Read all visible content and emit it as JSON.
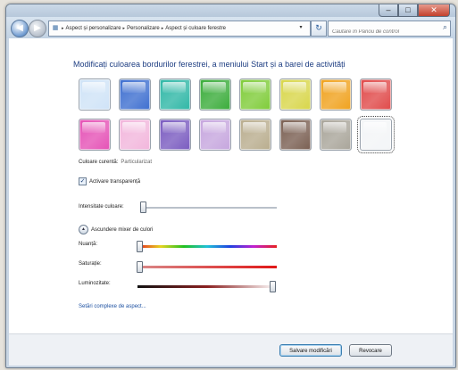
{
  "window": {
    "caption": {
      "minimize": "–",
      "maximize": "□",
      "close": "✕"
    }
  },
  "navbar": {
    "back_glyph": "◀",
    "forward_glyph": "▶",
    "breadcrumbs": [
      "Aspect și personalizare",
      "Personalizare",
      "Aspect și culoare ferestre"
    ],
    "refresh_glyph": "↻",
    "search_placeholder": "Căutare în Panou de control"
  },
  "main": {
    "heading": "Modificați culoarea bordurilor ferestrei, a meniului Start și a barei de activități",
    "current_color_label": "Culoare curentă:",
    "current_color_value": "Particularizat",
    "transparency_label": "Activare transparență",
    "transparency_checked": true,
    "intensity_label": "Intensitate culoare:",
    "intensity_value": 0.02,
    "mixer_label": "Ascundere mixer de culori",
    "hue_label": "Nuanță:",
    "hue_value": 0.01,
    "saturation_label": "Saturație:",
    "saturation_value": 0.01,
    "brightness_label": "Luminozitate:",
    "brightness_value": 0.97,
    "advanced_link": "Setări complexe de aspect..."
  },
  "swatches": [
    {
      "name": "sky",
      "color": "#cfe3f7"
    },
    {
      "name": "twilight",
      "color": "#3e6fd0"
    },
    {
      "name": "sea",
      "color": "#2fb7a6"
    },
    {
      "name": "leaf",
      "color": "#3aac3a"
    },
    {
      "name": "lime",
      "color": "#7fcc39"
    },
    {
      "name": "lemon",
      "color": "#d8d64a"
    },
    {
      "name": "pumpkin",
      "color": "#f0a21e"
    },
    {
      "name": "ruby",
      "color": "#e04a4a"
    },
    {
      "name": "fuchsia",
      "color": "#e552b6"
    },
    {
      "name": "blush",
      "color": "#f2b6dc"
    },
    {
      "name": "violet",
      "color": "#7a5bc0"
    },
    {
      "name": "lavender",
      "color": "#c6a6de"
    },
    {
      "name": "taupe",
      "color": "#b9ad8e"
    },
    {
      "name": "chocolate",
      "color": "#7a5f52"
    },
    {
      "name": "slate",
      "color": "#a9a59a"
    },
    {
      "name": "frost",
      "color": "#f3f5f7"
    }
  ],
  "footer": {
    "save_label": "Salvare modificări",
    "cancel_label": "Revocare"
  }
}
